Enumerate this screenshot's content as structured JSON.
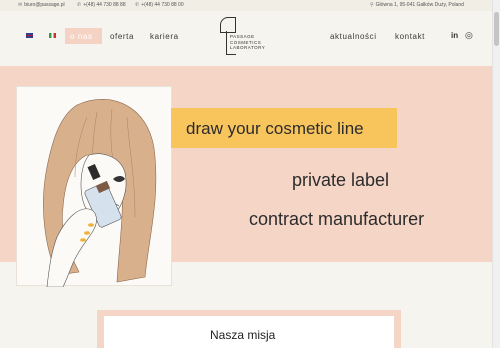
{
  "topbar": {
    "email": "biuro@passage.pl",
    "phone1": "+(48) 44 730 88 88",
    "phone2": "+(48) 44 730 88 00",
    "address": "Główna 1, 95-041 Gałków Duży, Poland",
    "icons": [
      "email-icon",
      "phone-icon",
      "phone-icon",
      "location-pin-icon"
    ]
  },
  "nav": {
    "languages": [
      "en",
      "it"
    ],
    "left_items": [
      "o nas",
      "oferta",
      "kariera"
    ],
    "right_items": [
      "aktualności",
      "kontakt"
    ],
    "active_item": "o nas",
    "social": [
      "linkedin",
      "instagram"
    ]
  },
  "logo": {
    "line1": "PASSAGE",
    "line2": "COSMETICS",
    "line3": "LABORATORY"
  },
  "hero": {
    "tagline": "draw your cosmetic line",
    "subtitle1": "private label",
    "subtitle2": "contract manufacturer"
  },
  "mission": {
    "title": "Nasza misja"
  },
  "colors": {
    "hero_bg": "#f5d5c6",
    "tagline_bg": "#f8c45c",
    "nav_active_bg": "#f4d2c4",
    "page_bg": "#f6f4ee"
  }
}
